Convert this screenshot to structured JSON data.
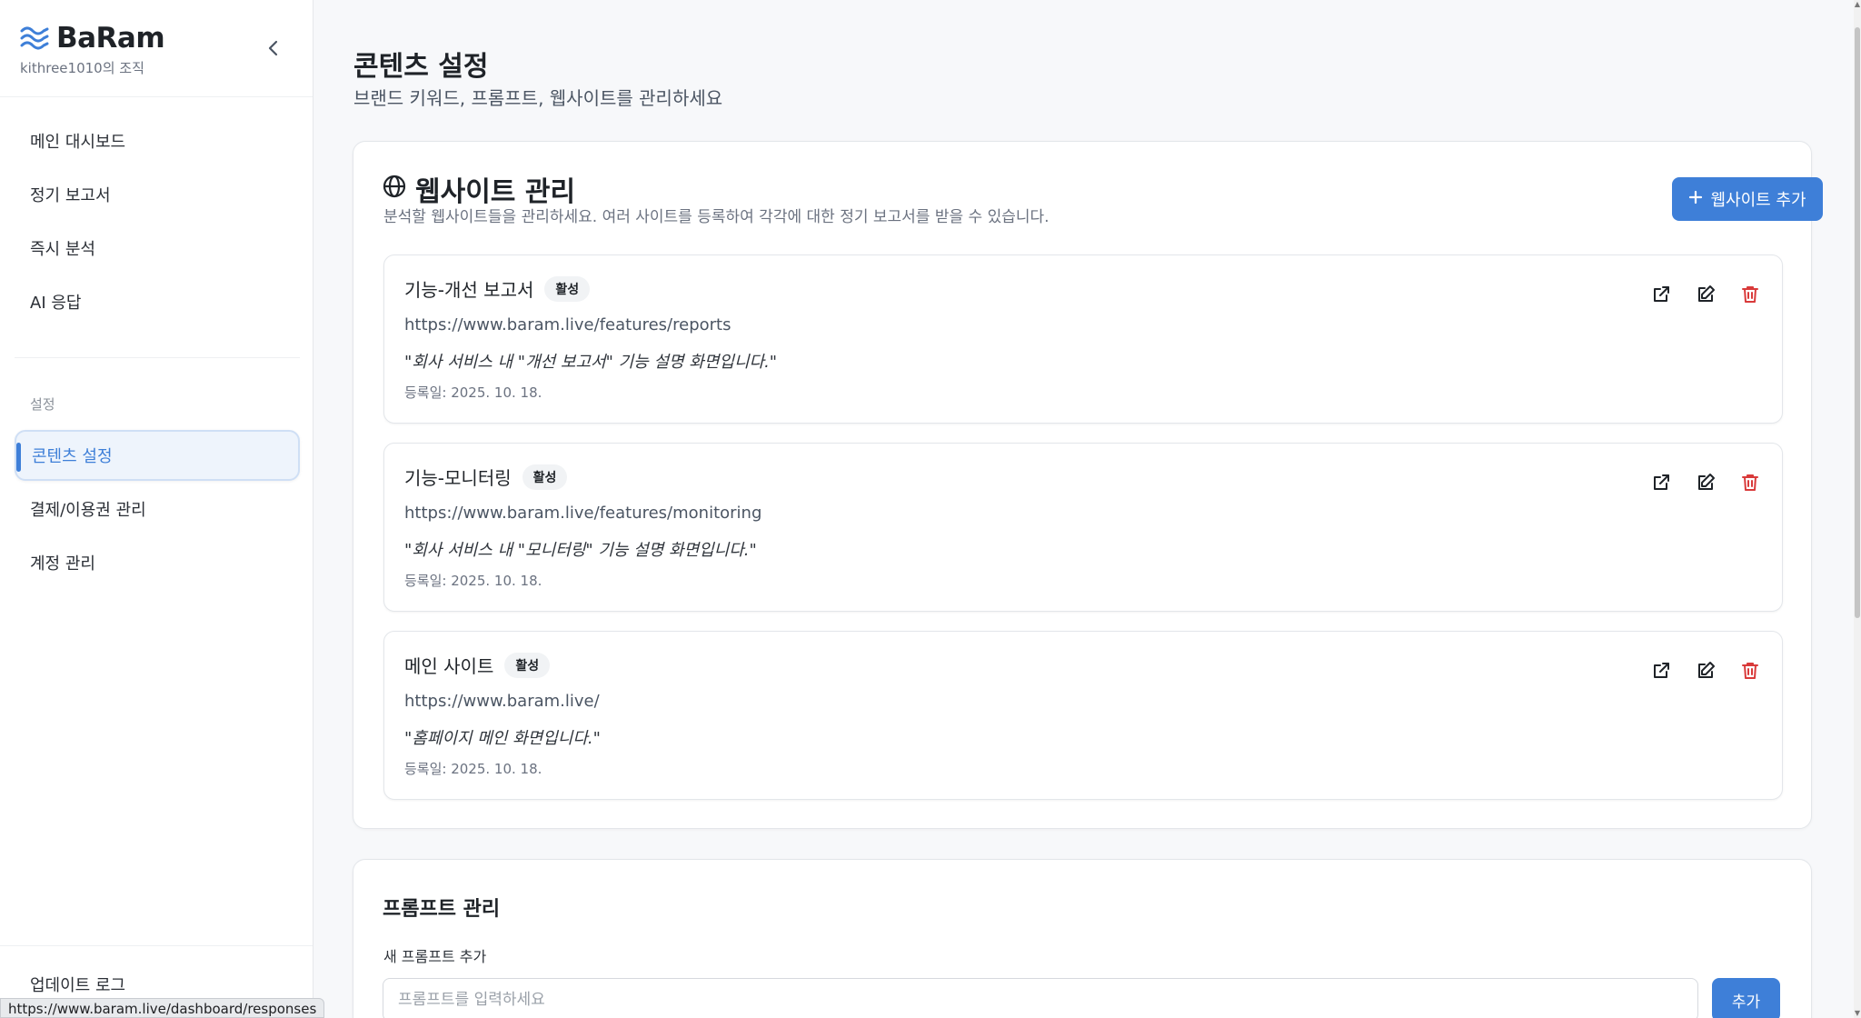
{
  "brand": {
    "name": "BaRam",
    "org": "kithree1010의 조직"
  },
  "sidebar": {
    "items": [
      {
        "label": "메인 대시보드"
      },
      {
        "label": "정기 보고서"
      },
      {
        "label": "즉시 분석"
      },
      {
        "label": "AI 응답"
      }
    ],
    "section_label": "설정",
    "settings_items": [
      {
        "label": "콘텐츠 설정",
        "active": true
      },
      {
        "label": "결제/이용권 관리"
      },
      {
        "label": "계정 관리"
      }
    ],
    "footer_item": "업데이트 로그"
  },
  "status_bar": {
    "url": "https://www.baram.live/dashboard/responses"
  },
  "page": {
    "title": "콘텐츠 설정",
    "subtitle": "브랜드 키워드, 프롬프트, 웹사이트를 관리하세요"
  },
  "websites": {
    "title": "웹사이트 관리",
    "description": "분석할 웹사이트들을 관리하세요. 여러 사이트를 등록하여 각각에 대한 정기 보고서를 받을 수 있습니다.",
    "add_button": "웹사이트 추가",
    "items": [
      {
        "name": "기능-개선 보고서",
        "badge": "활성",
        "url": "https://www.baram.live/features/reports",
        "description": "\"회사 서비스 내 \"개선 보고서\" 기능 설명 화면입니다.\"",
        "date": "등록일: 2025. 10. 18."
      },
      {
        "name": "기능-모니터링",
        "badge": "활성",
        "url": "https://www.baram.live/features/monitoring",
        "description": "\"회사 서비스 내 \"모니터링\" 기능 설명 화면입니다.\"",
        "date": "등록일: 2025. 10. 18."
      },
      {
        "name": "메인 사이트",
        "badge": "활성",
        "url": "https://www.baram.live/",
        "description": "\"홈페이지 메인 화면입니다.\"",
        "date": "등록일: 2025. 10. 18."
      }
    ]
  },
  "prompts": {
    "title": "프롬프트 관리",
    "new_label": "새 프롬프트 추가",
    "input_placeholder": "프롬프트를 입력하세요",
    "input_value": "",
    "add_button": "추가"
  },
  "colors": {
    "accent": "#3e7fd8",
    "delete": "#d93a3a",
    "active_bg": "#eef4fc"
  },
  "icons": {
    "logo": "wave-icon",
    "collapse": "chevron-left-icon",
    "section": "globe-icon",
    "add": "plus-icon",
    "open": "external-link-icon",
    "edit": "edit-icon",
    "delete": "trash-icon"
  }
}
